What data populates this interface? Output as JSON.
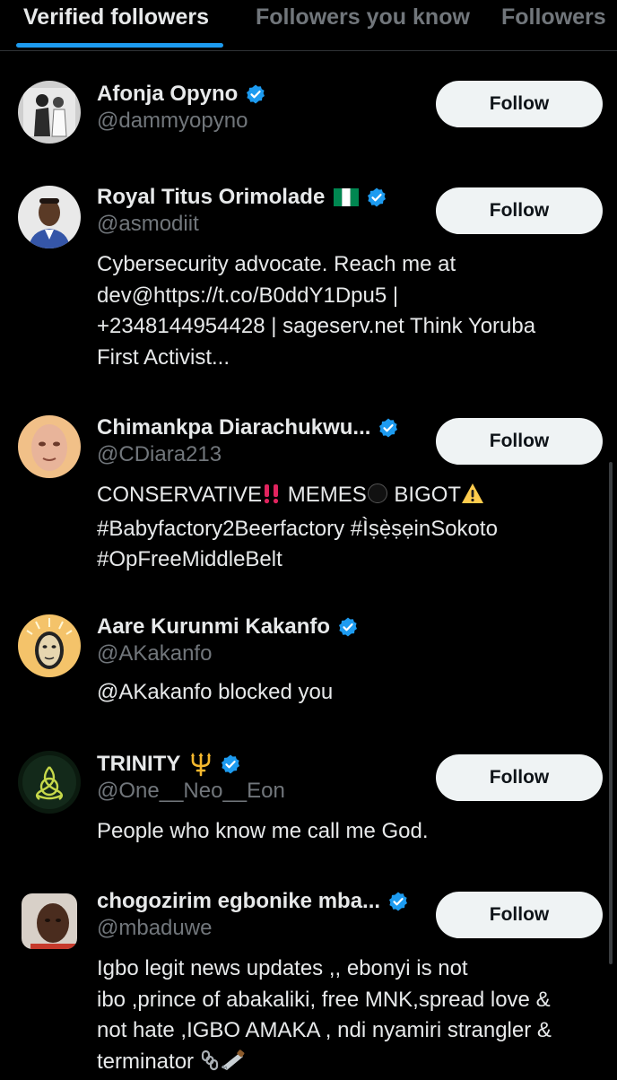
{
  "tabs": [
    {
      "label": "Verified followers",
      "active": true
    },
    {
      "label": "Followers you know",
      "active": false
    },
    {
      "label": "Followers",
      "active": false
    }
  ],
  "colors": {
    "background": "#000000",
    "verified_badge": "#1d9bf0",
    "button_bg": "#eff3f4",
    "secondary_text": "#71767b",
    "tab_indicator": "#1d9bf0"
  },
  "users": [
    {
      "name": "Afonja Opyno",
      "handle": "@dammyopyno",
      "verified": true,
      "follow_label": "Follow",
      "bio_lines": []
    },
    {
      "name": "Royal Titus Orimolade",
      "name_emoji": "nigeria-flag-icon",
      "handle": "@asmodiit",
      "verified": true,
      "follow_label": "Follow",
      "bio_lines": [
        "Cybersecurity advocate. Reach me at",
        "dev@https://t.co/B0ddY1Dpu5 |",
        "+2348144954428 | sageserv.net Think Yoruba",
        "First Activist..."
      ]
    },
    {
      "name": "Chimankpa Diarachukwu...",
      "handle": "@CDiara213",
      "verified": true,
      "follow_label": "Follow",
      "bio_lines": [
        {
          "before": "CONSERVATIVE",
          "icon1": "double-exclamation-icon",
          "middle1": " MEMES",
          "icon2": "black-circle-icon",
          "middle2": " BIGOT",
          "icon3": "warning-icon"
        },
        "#Babyfactory2Beerfactory #Ìṣẹ̀ṣẹinSokoto",
        "#OpFreeMiddleBelt"
      ]
    },
    {
      "name": "Aare Kurunmi Kakanfo",
      "handle": "@AKakanfo",
      "verified": true,
      "follow_label": "",
      "bio_lines": [
        "@AKakanfo blocked you"
      ]
    },
    {
      "name": "TRINITY",
      "name_emoji": "trident-icon",
      "handle": "@One__Neo__Eon",
      "verified": true,
      "follow_label": "Follow",
      "bio_lines": [
        "People who know me call me God."
      ]
    },
    {
      "name": "chogozirim egbonike mba...",
      "handle": "@mbaduwe",
      "verified": true,
      "follow_label": "Follow",
      "bio_lines": [
        "Igbo legit news updates ,, ebonyi is not",
        "ibo ,prince of abakaliki, free MNK,spread love &",
        "not hate ,IGBO AMAKA , ndi nyamiri strangler &",
        "terminator"
      ],
      "trailing_icons": [
        "chains-icon",
        "saw-icon"
      ]
    }
  ]
}
